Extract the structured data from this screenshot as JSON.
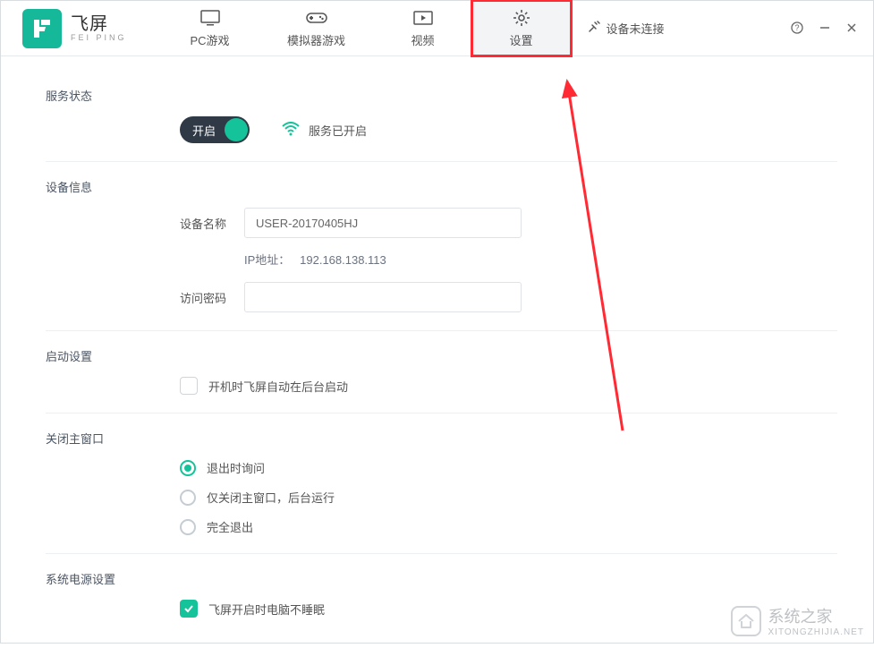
{
  "app": {
    "name_cn": "飞屏",
    "name_en": "FEI PING"
  },
  "tabs": {
    "pc": {
      "label": "PC游戏"
    },
    "emulator": {
      "label": "模拟器游戏"
    },
    "video": {
      "label": "视频"
    },
    "settings": {
      "label": "设置"
    }
  },
  "connection": {
    "status": "设备未连接"
  },
  "sections": {
    "service": {
      "title": "服务状态",
      "toggle_label": "开启",
      "running_text": "服务已开启"
    },
    "device": {
      "title": "设备信息",
      "name_label": "设备名称",
      "name_value": "USER-20170405HJ",
      "ip_label": "IP地址：",
      "ip_value": "192.168.138.113",
      "password_label": "访问密码",
      "password_value": ""
    },
    "startup": {
      "title": "启动设置",
      "bg_start_label": "开机时飞屏自动在后台启动"
    },
    "close": {
      "title": "关闭主窗口",
      "opt_ask": "退出时询问",
      "opt_bg": "仅关闭主窗口，后台运行",
      "opt_exit": "完全退出"
    },
    "power": {
      "title": "系统电源设置",
      "no_sleep_label": "飞屏开启时电脑不睡眠"
    }
  },
  "watermark": {
    "brand": "系统之家",
    "sub": "XITONGZHIJIA.NET"
  }
}
